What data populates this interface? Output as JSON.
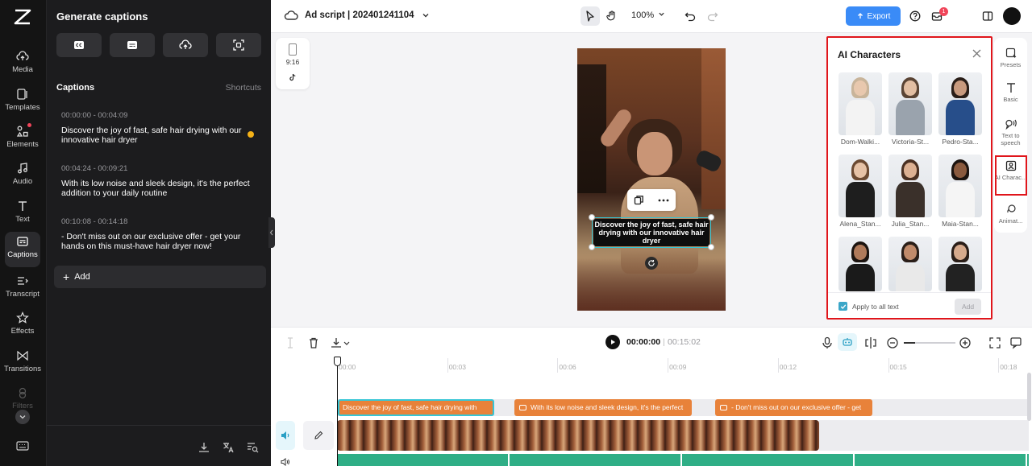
{
  "rail": {
    "items": [
      {
        "label": "Media",
        "icon": "cloud-upload-icon"
      },
      {
        "label": "Templates",
        "icon": "template-icon"
      },
      {
        "label": "Elements",
        "icon": "elements-icon"
      },
      {
        "label": "Audio",
        "icon": "music-note-icon"
      },
      {
        "label": "Text",
        "icon": "text-icon"
      },
      {
        "label": "Captions",
        "icon": "captions-icon"
      },
      {
        "label": "Transcript",
        "icon": "transcript-icon"
      },
      {
        "label": "Effects",
        "icon": "effects-icon"
      },
      {
        "label": "Transitions",
        "icon": "transitions-icon"
      },
      {
        "label": "Filters",
        "icon": "filters-icon"
      }
    ],
    "active": "Captions"
  },
  "captions_panel": {
    "title": "Generate captions",
    "section_title": "Captions",
    "shortcuts_label": "Shortcuts",
    "items": [
      {
        "time": "00:00:00 - 00:04:09",
        "text": "Discover the joy of fast, safe hair drying with our innovative hair dryer"
      },
      {
        "time": "00:04:24 - 00:09:21",
        "text": "With its low noise and sleek design, it's the perfect addition to your daily routine"
      },
      {
        "time": "00:10:08 - 00:14:18",
        "text": "- Don't miss out on our exclusive offer - get your hands on this must-have hair dryer now!"
      }
    ],
    "add_label": "Add"
  },
  "topbar": {
    "project_title": "Ad script | 202401241104",
    "zoom": "100%",
    "export_label": "Export",
    "notification_count": "1"
  },
  "canvas": {
    "ratio_label": "9:16",
    "caption_text": "Discover the joy of fast, safe hair drying with our innovative hair dryer"
  },
  "ai_characters": {
    "title": "AI Characters",
    "characters": [
      {
        "name": "Dom-Walki...",
        "hair": "#c8b49a",
        "skin": "#e8c8ae",
        "top": "#f3f3f3"
      },
      {
        "name": "Victoria-St...",
        "hair": "#5a4434",
        "skin": "#e2bea2",
        "top": "#9aa3ad"
      },
      {
        "name": "Pedro-Sta...",
        "hair": "#2a1e18",
        "skin": "#c89a7e",
        "top": "#274e8a"
      },
      {
        "name": "Alena_Stan...",
        "hair": "#6b4a32",
        "skin": "#e6c2a6",
        "top": "#1e1e1e"
      },
      {
        "name": "Julia_Stan...",
        "hair": "#4a3022",
        "skin": "#dcb092",
        "top": "#3a302a"
      },
      {
        "name": "Maia-Stan...",
        "hair": "#1c1410",
        "skin": "#8a5a3e",
        "top": "#f5f5f5"
      },
      {
        "name": "",
        "hair": "#1c1410",
        "skin": "#b07a5a",
        "top": "#1a1a1a"
      },
      {
        "name": "",
        "hair": "#2a1e18",
        "skin": "#c08a6a",
        "top": "#e9e9e9"
      },
      {
        "name": "",
        "hair": "#2a1e18",
        "skin": "#d6aa8c",
        "top": "#222222"
      }
    ],
    "apply_label": "Apply to all text",
    "add_label": "Add"
  },
  "right_side": {
    "items": [
      {
        "label": "Presets"
      },
      {
        "label": "Basic"
      },
      {
        "label": "Text to speech"
      },
      {
        "label": "AI Charac..."
      },
      {
        "label": "Animat..."
      }
    ]
  },
  "timeline": {
    "current_time": "00:00:00",
    "total_time": "00:15:02",
    "ruler": [
      "00:00",
      "00:03",
      "00:06",
      "00:09",
      "00:12",
      "00:15",
      "00:18"
    ],
    "caption_clips": [
      "Discover the joy of fast, safe hair drying with",
      "With its low noise and sleek design, it's the perfect",
      "- Don't miss out on our exclusive offer - get"
    ]
  },
  "colors": {
    "accent": "#3a8bf7",
    "highlight": "#e0151b",
    "clip_orange": "#e8823a",
    "selection_cyan": "#36c6d6"
  }
}
